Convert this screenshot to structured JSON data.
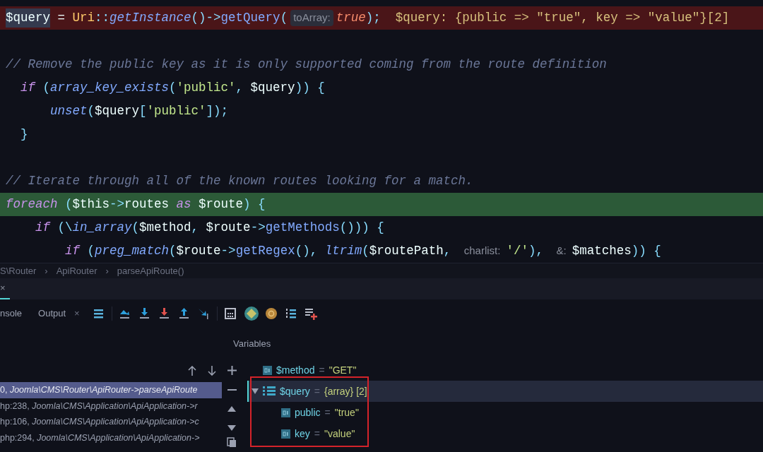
{
  "editor": {
    "lines": [
      {
        "breakpoint": true,
        "current": false,
        "tokens": [
          {
            "kind": "sel",
            "text": "$query"
          },
          {
            "kind": "plain",
            "text": " = "
          },
          {
            "kind": "cls",
            "text": "Uri"
          },
          {
            "kind": "op",
            "text": "::"
          },
          {
            "kind": "fn",
            "text": "getInstance"
          },
          {
            "kind": "op",
            "text": "()->"
          },
          {
            "kind": "call",
            "text": "getQuery"
          },
          {
            "kind": "op",
            "text": "("
          },
          {
            "kind": "hintbox",
            "text": "toArray:"
          },
          {
            "kind": "bool",
            "text": "true"
          },
          {
            "kind": "op",
            "text": ");"
          },
          {
            "kind": "inline",
            "text": "  $query: {public => \"true\", key => \"value\"}[2]"
          }
        ]
      },
      {
        "breakpoint": false,
        "current": false
      },
      {
        "breakpoint": false,
        "current": false,
        "tokens": [
          {
            "kind": "comment",
            "text": "// Remove the public key as it is only supported coming from the route definition"
          }
        ]
      },
      {
        "breakpoint": false,
        "current": false,
        "tokens": [
          {
            "kind": "kw",
            "text": "  if"
          },
          {
            "kind": "op",
            "text": " ("
          },
          {
            "kind": "fn",
            "text": "array_key_exists"
          },
          {
            "kind": "op",
            "text": "("
          },
          {
            "kind": "str",
            "text": "'public'"
          },
          {
            "kind": "op",
            "text": ", "
          },
          {
            "kind": "plain",
            "text": "$query"
          },
          {
            "kind": "op",
            "text": ")) {"
          }
        ]
      },
      {
        "breakpoint": false,
        "current": false,
        "tokens": [
          {
            "kind": "fn",
            "text": "      unset"
          },
          {
            "kind": "op",
            "text": "("
          },
          {
            "kind": "plain",
            "text": "$query"
          },
          {
            "kind": "op",
            "text": "["
          },
          {
            "kind": "str",
            "text": "'public'"
          },
          {
            "kind": "op",
            "text": "]);"
          }
        ]
      },
      {
        "breakpoint": false,
        "current": false,
        "tokens": [
          {
            "kind": "op",
            "text": "  }"
          }
        ]
      },
      {
        "breakpoint": false,
        "current": false
      },
      {
        "breakpoint": false,
        "current": false,
        "tokens": [
          {
            "kind": "comment",
            "text": "// Iterate through all of the known routes looking for a match."
          }
        ]
      },
      {
        "breakpoint": false,
        "current": true,
        "tokens": [
          {
            "kind": "kw",
            "text": "foreach"
          },
          {
            "kind": "op",
            "text": " ("
          },
          {
            "kind": "plain",
            "text": "$this"
          },
          {
            "kind": "op",
            "text": "->"
          },
          {
            "kind": "plain",
            "text": "routes "
          },
          {
            "kind": "kw",
            "text": "as"
          },
          {
            "kind": "plain",
            "text": " $route"
          },
          {
            "kind": "op",
            "text": ") {"
          }
        ]
      },
      {
        "breakpoint": false,
        "current": false,
        "tokens": [
          {
            "kind": "kw",
            "text": "    if"
          },
          {
            "kind": "op",
            "text": " ("
          },
          {
            "kind": "op",
            "text": "\\"
          },
          {
            "kind": "fn",
            "text": "in_array"
          },
          {
            "kind": "op",
            "text": "("
          },
          {
            "kind": "plain",
            "text": "$method"
          },
          {
            "kind": "op",
            "text": ", "
          },
          {
            "kind": "plain",
            "text": "$route"
          },
          {
            "kind": "op",
            "text": "->"
          },
          {
            "kind": "call",
            "text": "getMethods"
          },
          {
            "kind": "op",
            "text": "())) {"
          }
        ]
      },
      {
        "breakpoint": false,
        "current": false,
        "tokens": [
          {
            "kind": "kw",
            "text": "        if"
          },
          {
            "kind": "op",
            "text": " ("
          },
          {
            "kind": "fn",
            "text": "preg_match"
          },
          {
            "kind": "op",
            "text": "("
          },
          {
            "kind": "plain",
            "text": "$route"
          },
          {
            "kind": "op",
            "text": "->"
          },
          {
            "kind": "call",
            "text": "getRegex"
          },
          {
            "kind": "op",
            "text": "(), "
          },
          {
            "kind": "fn",
            "text": "ltrim"
          },
          {
            "kind": "op",
            "text": "("
          },
          {
            "kind": "plain",
            "text": "$routePath"
          },
          {
            "kind": "op",
            "text": ", "
          },
          {
            "kind": "hint",
            "text": "charlist:"
          },
          {
            "kind": "str",
            "text": "'/'"
          },
          {
            "kind": "op",
            "text": "), "
          },
          {
            "kind": "hint",
            "text": "&:"
          },
          {
            "kind": "plain",
            "text": "$matches"
          },
          {
            "kind": "op",
            "text": ")) {"
          }
        ]
      }
    ]
  },
  "breadcrumb": {
    "separator": "›",
    "items": [
      "S\\Router",
      "ApiRouter",
      "parseApiRoute()"
    ]
  },
  "debug_tabs": [
    {
      "label": "×",
      "selected": true
    }
  ],
  "toolbar": {
    "tabs": [
      {
        "label": "nsole"
      },
      {
        "label": "Output",
        "close": "×"
      }
    ]
  },
  "variables_title": "Variables",
  "frames": [
    {
      "text": "0, *Joomla\\CMS\\Router\\ApiRouter->parseApiRoute*",
      "selected": true
    },
    {
      "text": "hp:238, *Joomla\\CMS\\Application\\ApiApplication->r*",
      "selected": false
    },
    {
      "text": "hp:106, *Joomla\\CMS\\Application\\ApiApplication->c*",
      "selected": false
    },
    {
      "text": "php:294, *Joomla\\CMS\\Application\\ApiApplication->*",
      "selected": false
    }
  ],
  "variables": [
    {
      "kind": "scalar",
      "name": "$method",
      "operator": "=",
      "value": "\"GET\"",
      "selected": false
    },
    {
      "kind": "array",
      "name": "$query",
      "operator": "=",
      "value": "{array} [2]",
      "selected": true,
      "expanded": true,
      "children": [
        {
          "kind": "scalar",
          "name": "public",
          "operator": "=",
          "value": "\"true\"",
          "selected": false
        },
        {
          "kind": "scalar",
          "name": "key",
          "operator": "=",
          "value": "\"value\"",
          "selected": false
        }
      ]
    }
  ]
}
